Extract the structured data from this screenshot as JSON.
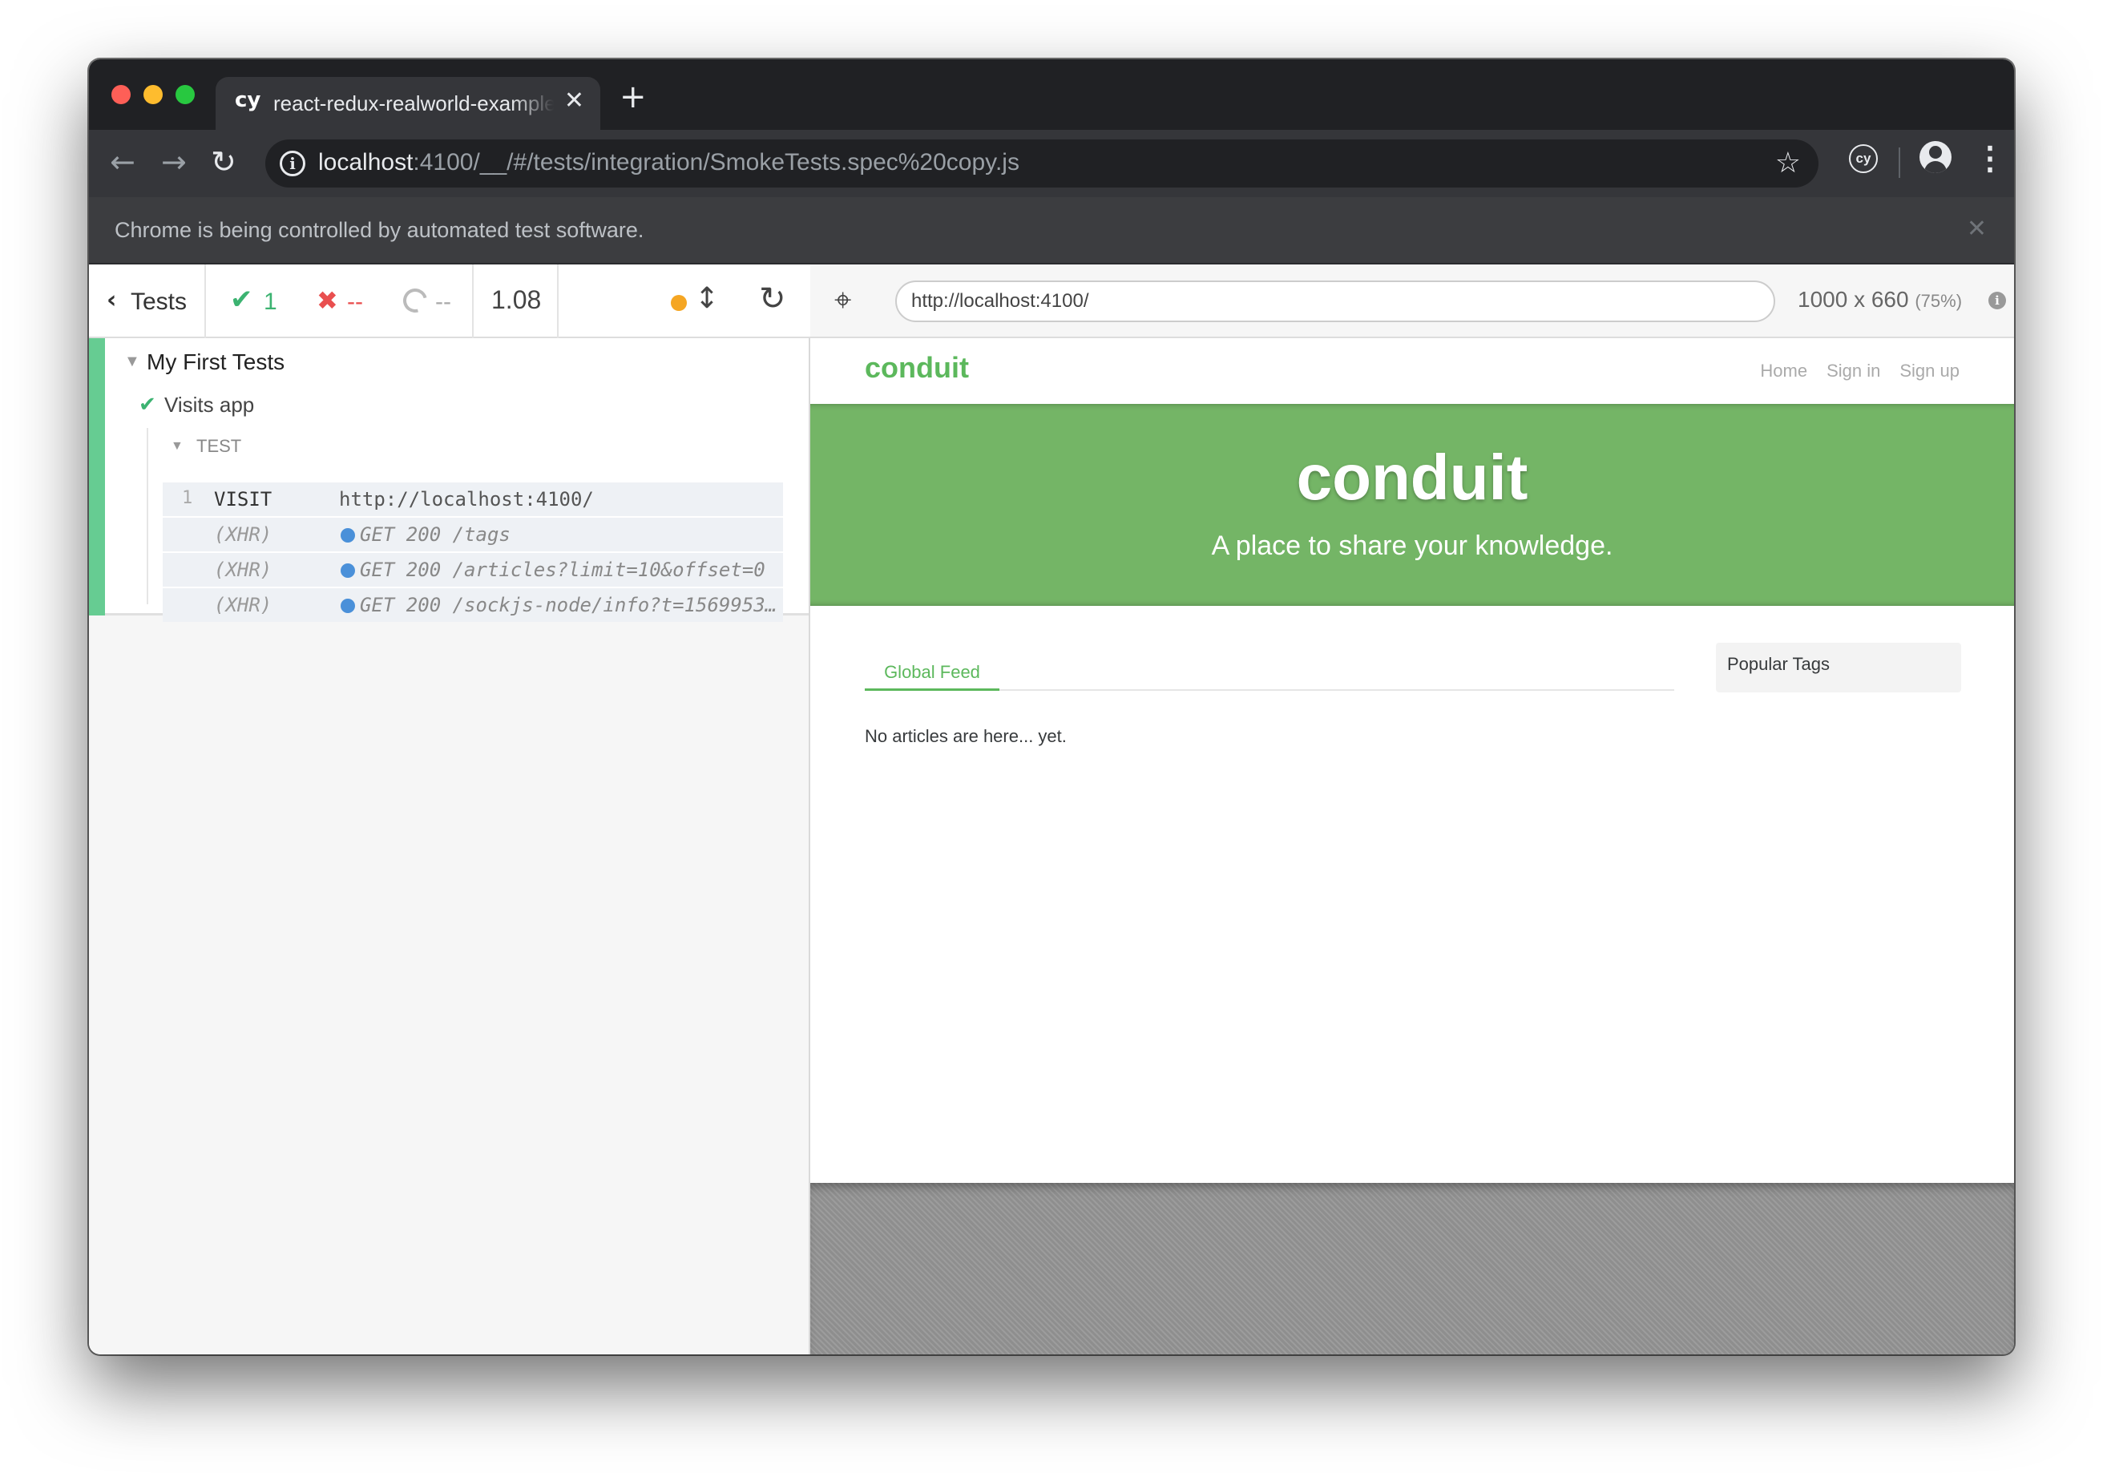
{
  "browser": {
    "tab": {
      "favicon": "cy",
      "title": "react-redux-realworld-example-app",
      "close": "✕"
    },
    "new_tab": "+",
    "nav": {
      "back": "←",
      "forward": "→",
      "reload": "↻"
    },
    "address": {
      "host": "localhost",
      "path": ":4100/__/#/tests/integration/SmokeTests.spec%20copy.js",
      "info": "i",
      "star": "☆"
    },
    "extension_label": "cy",
    "kebab": "⋮",
    "infobar": {
      "text": "Chrome is being controlled by automated test software.",
      "close": "✕"
    }
  },
  "reporter": {
    "tests_label": "Tests",
    "back_chevron": "‹",
    "stats": {
      "pass_icon": "✔",
      "passed": "1",
      "fail_icon": "✖",
      "failed": "--",
      "pending": "--"
    },
    "duration": "1.08",
    "scroll_icon": "↕",
    "rerun_icon": "↻",
    "suite": {
      "toggle": "▼",
      "title": "My First Tests",
      "test": {
        "pass_icon": "✔",
        "title": "Visits app",
        "hook": {
          "toggle": "▼",
          "title": "TEST",
          "commands": [
            {
              "number": "1",
              "name": "VISIT",
              "message": "http://localhost:4100/"
            },
            {
              "number": "",
              "name": "(XHR)",
              "message": "GET 200 /tags"
            },
            {
              "number": "",
              "name": "(XHR)",
              "message": "GET 200 /articles?limit=10&offset=0"
            },
            {
              "number": "",
              "name": "(XHR)",
              "message": "GET 200 /sockjs-node/info?t=1569953..."
            }
          ]
        }
      }
    }
  },
  "aut": {
    "selector_icon": "⌖",
    "url": "http://localhost:4100/",
    "viewport": "1000 x 660",
    "scale": "(75%)",
    "info": "i",
    "app": {
      "brand": "conduit",
      "nav": [
        "Home",
        "Sign in",
        "Sign up"
      ],
      "banner_title": "conduit",
      "banner_subtitle": "A place to share your knowledge.",
      "feed_tab": "Global Feed",
      "empty_message": "No articles are here... yet.",
      "sidebar_title": "Popular Tags"
    }
  },
  "colors": {
    "conduit_green": "#5cb85c",
    "banner_green": "#74b566",
    "pass_green": "#3cb371",
    "fail_red": "#e94f4f",
    "running_orange": "#f5a623",
    "xhr_blue": "#4a90d9"
  }
}
